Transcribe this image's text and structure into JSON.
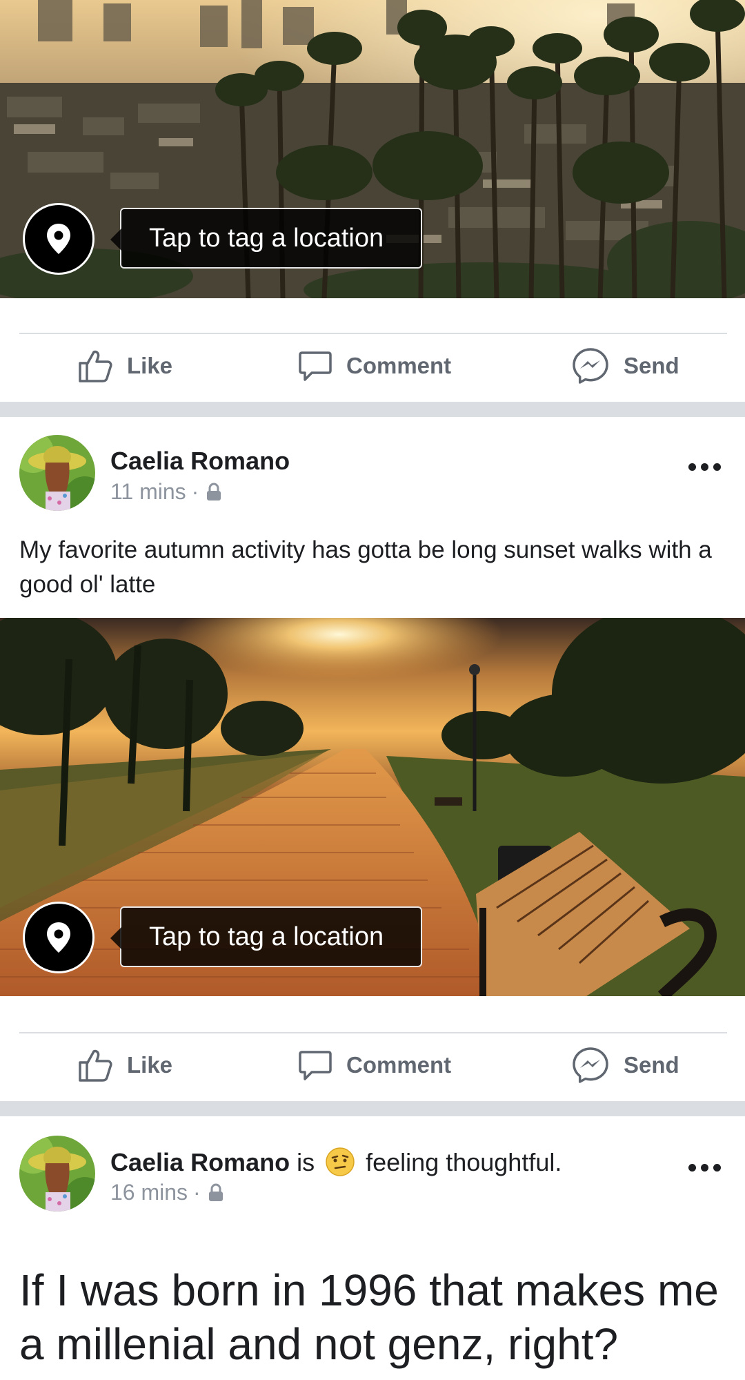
{
  "posts": [
    {
      "tag_location_label": "Tap to tag a location",
      "actions": {
        "like": "Like",
        "comment": "Comment",
        "send": "Send"
      }
    },
    {
      "author": "Caelia Romano",
      "time": "11 mins",
      "separator": "·",
      "privacy_icon": "lock-icon",
      "text": "My favorite autumn activity has gotta be long sunset walks with a good ol' latte",
      "tag_location_label": "Tap to tag a location",
      "actions": {
        "like": "Like",
        "comment": "Comment",
        "send": "Send"
      }
    },
    {
      "author": "Caelia Romano",
      "verb": "is",
      "feeling": "feeling thoughtful.",
      "time": "16 mins",
      "separator": "·",
      "privacy_icon": "lock-icon",
      "text": "If I was born in 1996 that makes me a millenial and not genz, right?"
    }
  ],
  "colors": {
    "action_gray": "#606770",
    "meta_gray": "#8d949e",
    "divider": "#dadde1"
  }
}
